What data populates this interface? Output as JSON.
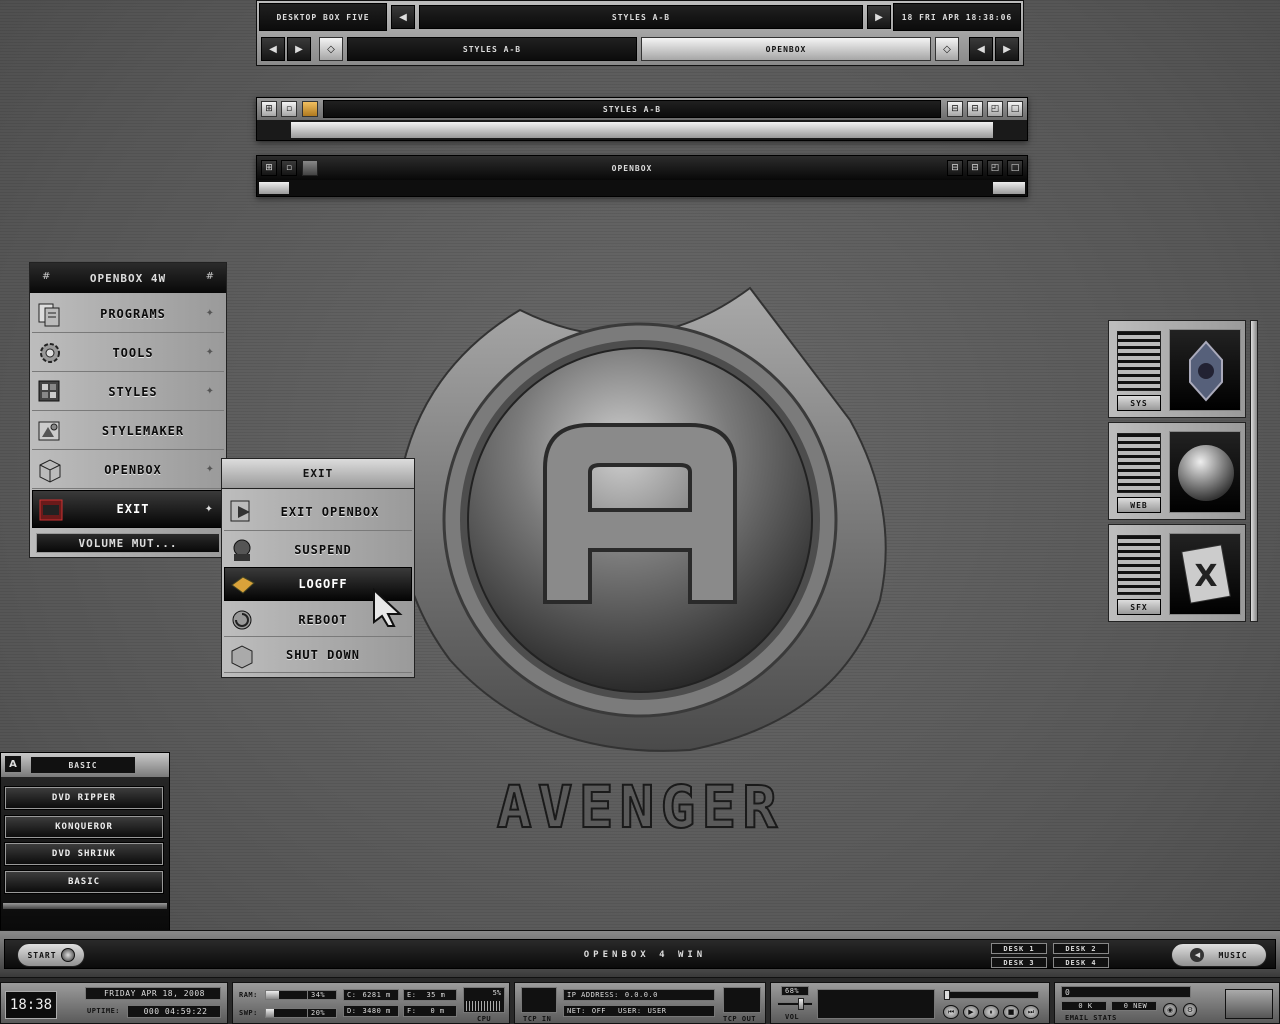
{
  "colors": {
    "accent": "#d9a23a",
    "dark": "#101010",
    "light": "#d8d8d8"
  },
  "top_panel": {
    "desktop_name": "desktop box five",
    "active_title": "styles a-b",
    "clock": "18 fri apr 18:38:06",
    "tasks": [
      {
        "label": "styles a-b",
        "active": false
      },
      {
        "label": "openbox",
        "active": true
      }
    ]
  },
  "window1": {
    "title": "styles a-b"
  },
  "window2": {
    "title": "openbox"
  },
  "root_menu": {
    "title": "openbox 4w",
    "items": [
      {
        "label": "programs",
        "icon": "programs-icon"
      },
      {
        "label": "tools",
        "icon": "gear-icon"
      },
      {
        "label": "styles",
        "icon": "styles-icon"
      },
      {
        "label": "stylemaker",
        "icon": "stylemaker-icon"
      },
      {
        "label": "openbox",
        "icon": "box-icon"
      },
      {
        "label": "exit",
        "icon": "exit-icon"
      }
    ],
    "footer": "volume mut..."
  },
  "exit_menu": {
    "title": "exit",
    "items": [
      {
        "label": "exit openbox",
        "icon": "exit-openbox-icon"
      },
      {
        "label": "suspend",
        "icon": "suspend-icon"
      },
      {
        "label": "logoff",
        "icon": "logoff-icon"
      },
      {
        "label": "reboot",
        "icon": "reboot-icon"
      },
      {
        "label": "shut down",
        "icon": "shutdown-icon"
      }
    ]
  },
  "wallpaper": {
    "logo_text": "AVENGER"
  },
  "right_dock": {
    "items": [
      {
        "label": "sys"
      },
      {
        "label": "web"
      },
      {
        "label": "sfx"
      }
    ]
  },
  "left_panel": {
    "title": "basic",
    "buttons": [
      "dvd ripper",
      "konqueror",
      "dvd shrink",
      "basic"
    ]
  },
  "taskbar": {
    "start": "start",
    "center": "openbox 4 win",
    "desks": [
      "desk 1",
      "desk 2",
      "desk 3",
      "desk 4"
    ],
    "music": "music"
  },
  "bottom_bar": {
    "time": "18:38",
    "date": "friday apr 18, 2008",
    "uptime_label": "uptime:",
    "uptime": "000 04:59:22",
    "ram_label": "ram:",
    "ram_pct": "34%",
    "ram_fraction": 0.34,
    "swp_label": "swp:",
    "swp_pct": "20%",
    "swp_fraction": 0.2,
    "c_label": "c:",
    "c_val": "6281 m",
    "d_label": "d:",
    "d_val": "3480 m",
    "e_label": "e:",
    "e_val": "35 m",
    "f_label": "f:",
    "f_val": "0 m",
    "cpu_pct": "5%",
    "cpu_label": "cpu",
    "tcp_in": "tcp in",
    "tcp_out": "tcp out",
    "ip_label": "ip address:",
    "ip": "0.0.0.0",
    "net_label": "net:",
    "net": "off",
    "user_label": "user:",
    "user": "user",
    "vol_pct": "68%",
    "vol_label": "vol",
    "vol_fraction": 0.68,
    "email_count": "0",
    "email_k": "0 k",
    "email_new": "0 new",
    "email_label": "email stats"
  }
}
